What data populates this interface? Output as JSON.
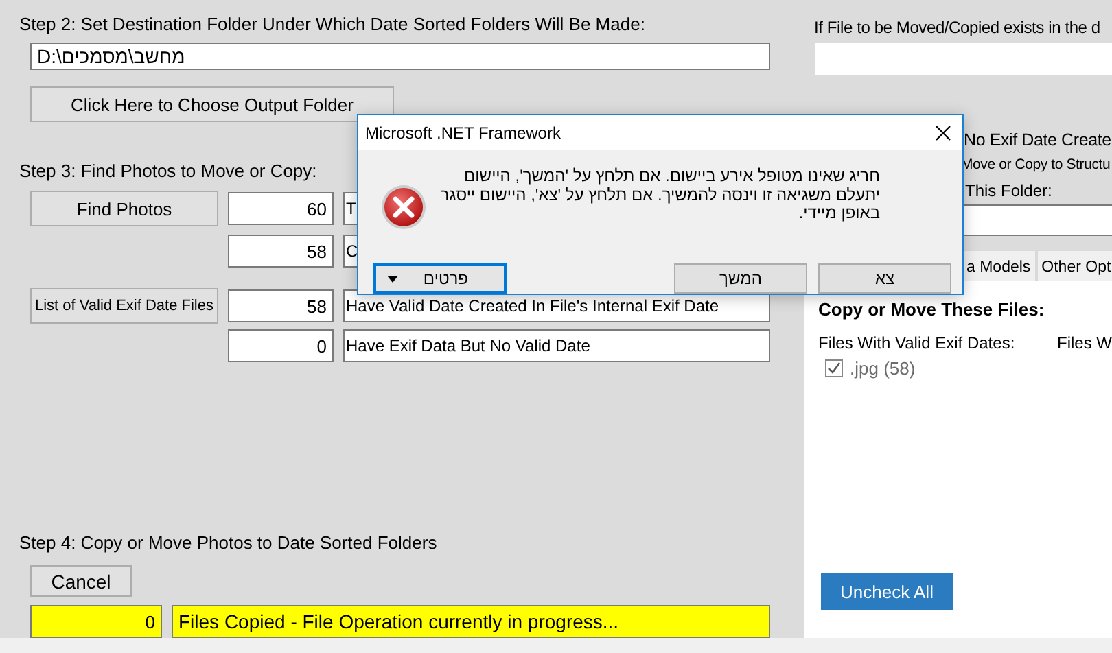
{
  "step2": {
    "label": "Step 2: Set Destination Folder Under Which Date Sorted Folders Will Be Made:",
    "path": "D:\\מחשב\\מסמכים",
    "choose_button": "Click Here to Choose Output Folder"
  },
  "step3": {
    "label": "Step 3: Find Photos to Move or Copy:",
    "rows": [
      {
        "button": "Find Photos",
        "count": "60",
        "text": "T"
      },
      {
        "count": "58",
        "text": "C"
      },
      {
        "button": "List of Valid Exif Date Files",
        "count": "58",
        "text": "Have Valid Date Created In File's Internal Exif Date"
      },
      {
        "count": "0",
        "text": "Have Exif Data But No Valid Date"
      }
    ]
  },
  "step4": {
    "label": "Step 4: Copy or Move Photos to Date Sorted Folders",
    "cancel_button": "Cancel",
    "copied_count": "0",
    "status": "Files Copied - File Operation currently in progress..."
  },
  "right_panel": {
    "exists_label": "If File to be Moved/Copied exists in the d",
    "no_exif_label": "No Exif Date Create",
    "move_label": "Move or Copy to Structu",
    "folder_label": "This Folder:",
    "tabs": [
      {
        "label": "a Models",
        "selected": false
      },
      {
        "label": "Other Opt",
        "selected": false
      }
    ],
    "group_title": "Copy or Move These Files:",
    "column_1": "Files With Valid Exif Dates:",
    "column_2": "Files W",
    "files": [
      {
        "label": ".jpg (58)",
        "checked": true,
        "disabled": true
      }
    ],
    "uncheck_button": "Uncheck All"
  },
  "dialog": {
    "title": "Microsoft .NET Framework",
    "message": "חריג שאינו מטופל אירע ביישום. אם תלחץ על 'המשך', היישום יתעלם משגיאה זו וינסה להמשיך. אם תלחץ על 'צא', היישום ייסגר באופן מיידי.",
    "buttons": [
      {
        "kind": "plain",
        "label": "צא",
        "focused": false
      },
      {
        "kind": "plain",
        "label": "המשך",
        "focused": false
      },
      {
        "kind": "details",
        "label": "פרטים",
        "focused": true
      }
    ]
  }
}
